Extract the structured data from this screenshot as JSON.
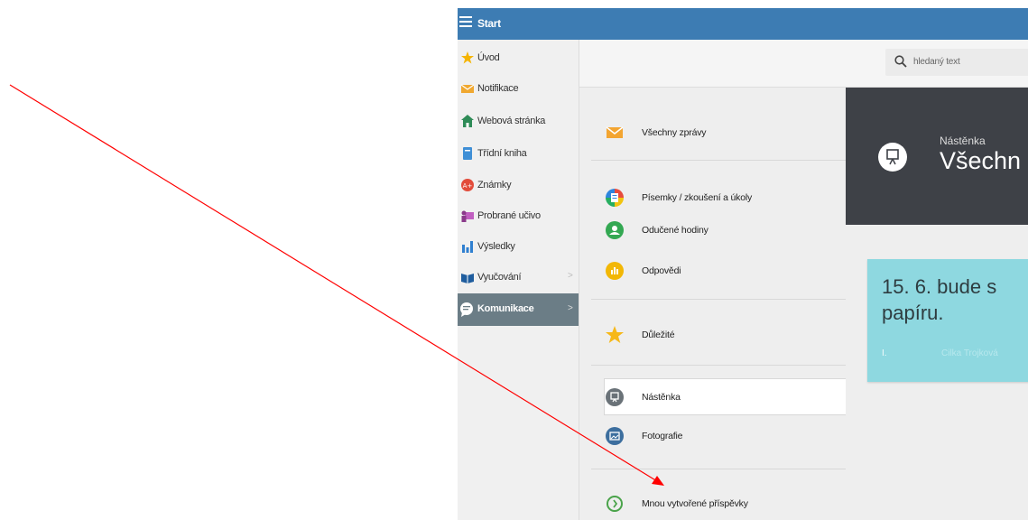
{
  "topbar": {
    "title": "Start"
  },
  "sidebar": {
    "items": [
      {
        "label": "Úvod",
        "icon": "star-icon"
      },
      {
        "label": "Notifikace",
        "icon": "envelope-icon"
      },
      {
        "label": "Webová stránka",
        "icon": "home-icon"
      },
      {
        "label": "Třídní kniha",
        "icon": "book-icon"
      },
      {
        "label": "Známky",
        "icon": "grades-icon"
      },
      {
        "label": "Probrané učivo",
        "icon": "teacher-icon"
      },
      {
        "label": "Výsledky",
        "icon": "bar-chart-icon"
      },
      {
        "label": "Vyučování",
        "icon": "open-book-icon",
        "has_submenu": true
      },
      {
        "label": "Komunikace",
        "icon": "chat-icon",
        "has_submenu": true,
        "active": true
      }
    ],
    "chevron": ">"
  },
  "search": {
    "placeholder": "hledaný text"
  },
  "menu": {
    "items": [
      {
        "label": "Všechny zprávy",
        "icon": "envelope-icon"
      },
      {
        "label": "Písemky / zkoušení a úkoly",
        "icon": "tasks-icon"
      },
      {
        "label": "Odučené hodiny",
        "icon": "lessons-icon"
      },
      {
        "label": "Odpovědi",
        "icon": "answers-icon"
      },
      {
        "label": "Důležité",
        "icon": "star-icon"
      },
      {
        "label": "Nástěnka",
        "icon": "noticeboard-icon",
        "active": true
      },
      {
        "label": "Fotografie",
        "icon": "photo-icon"
      },
      {
        "label": "Mnou vytvořené příspěvky",
        "icon": "my-posts-icon"
      }
    ]
  },
  "header": {
    "subtitle": "Nástěnka",
    "title": "Všechn"
  },
  "card": {
    "line1": "15. 6. bude s",
    "line2": "papíru.",
    "meta_left": "I.",
    "meta_author": "Cilka Trojková",
    "color": "#8ed8e0"
  },
  "colors": {
    "topbar": "#3d7cb3",
    "sidebar_active": "#6b7d86",
    "header_dark": "#3e4147",
    "annotation_arrow": "#ff0000"
  }
}
